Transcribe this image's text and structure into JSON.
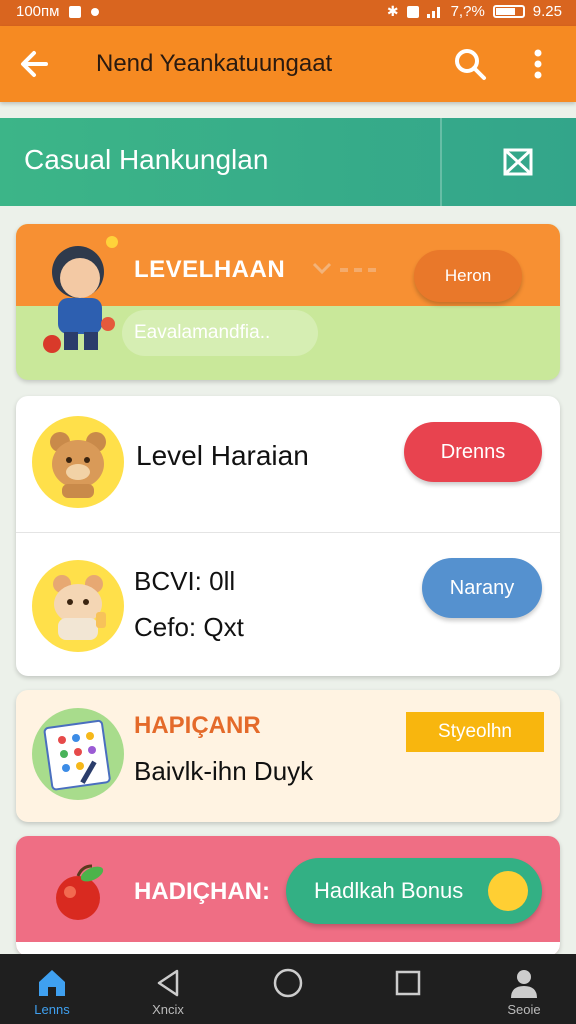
{
  "status_bar": {
    "left_text": "100пм",
    "right_text": "7,?%",
    "time": "9.25"
  },
  "app_bar": {
    "title": "Nend Yeankatuungaat"
  },
  "sub_header": {
    "title": "Casual Hankunglan"
  },
  "card_level": {
    "heading": "LEVELHAAN",
    "button": "Heron",
    "pill": "Eavalamandfia.."
  },
  "card_list": {
    "row1": {
      "title": "Level Haraian",
      "button": "Drenns"
    },
    "row2": {
      "line1": "BCVI: 0ll",
      "line2": "Cefo: Qxt",
      "button": "Narany"
    }
  },
  "card_promo": {
    "heading": "HAPIÇANR",
    "subtitle": "Baivlk-ihn Duyk",
    "badge": "Styeolhn"
  },
  "card_bonus": {
    "label": "HADIÇHAN:",
    "button": "Hadlkah Bonus"
  },
  "nav": {
    "items": [
      {
        "label": "Lenns"
      },
      {
        "label": "Xncix"
      },
      {
        "label": ""
      },
      {
        "label": ""
      },
      {
        "label": "Seoie"
      }
    ]
  },
  "colors": {
    "status": "#d9651f",
    "app_bar": "#f68a22",
    "sub_header": "#3cb588",
    "red": "#e8434f",
    "blue": "#5591cf",
    "pink": "#ef6e84",
    "green": "#33b084"
  }
}
